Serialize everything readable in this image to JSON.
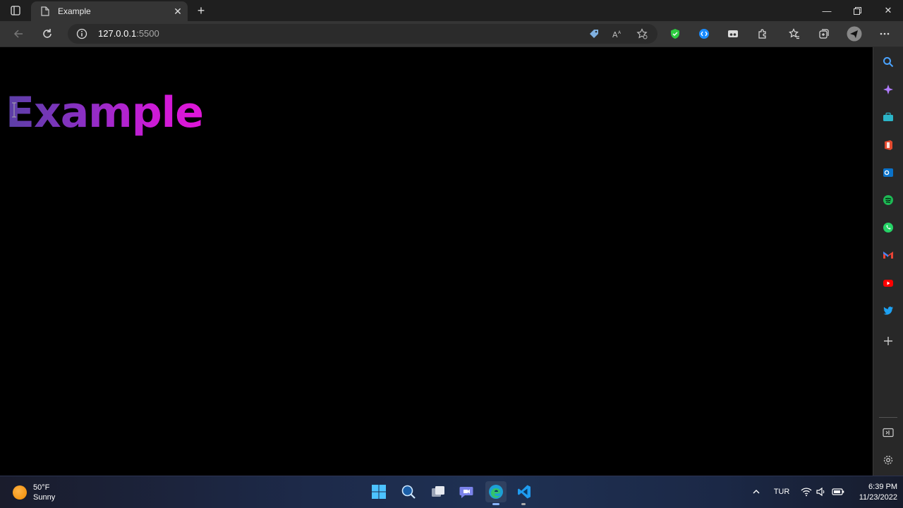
{
  "browser": {
    "tab": {
      "title": "Example"
    },
    "address_bar": {
      "host": "127.0.0.1",
      "port": ":5500"
    }
  },
  "page": {
    "heading": "Example"
  },
  "sidebar": {
    "items": [
      "search",
      "copilot",
      "shopping",
      "office",
      "outlook",
      "spotify",
      "whatsapp",
      "gmail",
      "youtube",
      "twitter",
      "add"
    ]
  },
  "taskbar": {
    "weather": {
      "temperature": "50°F",
      "condition": "Sunny"
    },
    "language": "TUR",
    "time": "6:39 PM",
    "date": "11/23/2022"
  },
  "colors": {
    "heading_gradient": [
      "#5a3fa6",
      "#8c2fc4",
      "#cc1bd6",
      "#e016d8"
    ],
    "tab_bar": "#1f1f1f",
    "toolbar": "#353535"
  }
}
